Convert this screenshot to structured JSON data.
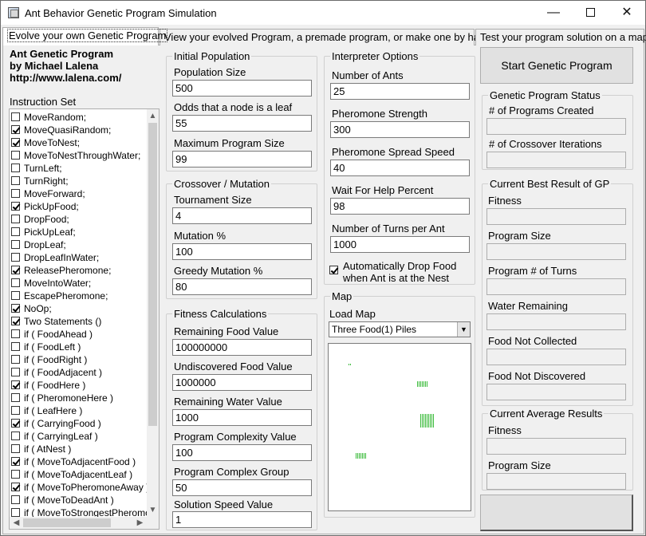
{
  "window": {
    "title": "Ant Behavior Genetic Program Simulation",
    "minimize": "—",
    "close": "✕"
  },
  "tabs": [
    {
      "label": "Evolve your own Genetic Program"
    },
    {
      "label": "View your evolved Program, a premade program, or make one by hand"
    },
    {
      "label": "Test your program solution on a map"
    }
  ],
  "credits": {
    "line1": "Ant Genetic Program",
    "line2": "by Michael Lalena",
    "line3": "http://www.lalena.com/"
  },
  "instruction_set": {
    "label": "Instruction Set",
    "items": [
      {
        "label": "MoveRandom;",
        "checked": false
      },
      {
        "label": "MoveQuasiRandom;",
        "checked": true
      },
      {
        "label": "MoveToNest;",
        "checked": true
      },
      {
        "label": "MoveToNestThroughWater;",
        "checked": false
      },
      {
        "label": "TurnLeft;",
        "checked": false
      },
      {
        "label": "TurnRight;",
        "checked": false
      },
      {
        "label": "MoveForward;",
        "checked": false
      },
      {
        "label": "PickUpFood;",
        "checked": true
      },
      {
        "label": "DropFood;",
        "checked": false
      },
      {
        "label": "PickUpLeaf;",
        "checked": false
      },
      {
        "label": "DropLeaf;",
        "checked": false
      },
      {
        "label": "DropLeafInWater;",
        "checked": false
      },
      {
        "label": "ReleasePheromone;",
        "checked": true
      },
      {
        "label": "MoveIntoWater;",
        "checked": false
      },
      {
        "label": "EscapePheromone;",
        "checked": false
      },
      {
        "label": "NoOp;",
        "checked": true
      },
      {
        "label": "Two Statements ()",
        "checked": true
      },
      {
        "label": "if ( FoodAhead )",
        "checked": false
      },
      {
        "label": "if ( FoodLeft )",
        "checked": false
      },
      {
        "label": "if ( FoodRight )",
        "checked": false
      },
      {
        "label": "if ( FoodAdjacent )",
        "checked": false
      },
      {
        "label": "if ( FoodHere )",
        "checked": true
      },
      {
        "label": "if ( PheromoneHere )",
        "checked": false
      },
      {
        "label": "if ( LeafHere )",
        "checked": false
      },
      {
        "label": "if ( CarryingFood )",
        "checked": true
      },
      {
        "label": "if ( CarryingLeaf )",
        "checked": false
      },
      {
        "label": "if ( AtNest )",
        "checked": false
      },
      {
        "label": "if ( MoveToAdjacentFood )",
        "checked": true
      },
      {
        "label": "if ( MoveToAdjacentLeaf )",
        "checked": false
      },
      {
        "label": "if ( MoveToPheromoneAway )",
        "checked": true
      },
      {
        "label": "if ( MoveToDeadAnt )",
        "checked": false
      },
      {
        "label": "if ( MoveToStrongestPheromone )",
        "checked": false
      }
    ]
  },
  "initial_population": {
    "legend": "Initial Population",
    "population_size_label": "Population Size",
    "population_size": "500",
    "odds_leaf_label": "Odds that a node is a leaf",
    "odds_leaf": "55",
    "max_program_size_label": "Maximum Program Size",
    "max_program_size": "99"
  },
  "crossover": {
    "legend": "Crossover / Mutation",
    "tournament_size_label": "Tournament Size",
    "tournament_size": "4",
    "mutation_label": "Mutation %",
    "mutation": "100",
    "greedy_mutation_label": "Greedy Mutation %",
    "greedy_mutation": "80"
  },
  "fitness": {
    "legend": "Fitness Calculations",
    "remaining_food_label": "Remaining Food Value",
    "remaining_food": "100000000",
    "undiscovered_food_label": "Undiscovered Food Value",
    "undiscovered_food": "1000000",
    "remaining_water_label": "Remaining Water Value",
    "remaining_water": "1000",
    "complexity_value_label": "Program Complexity Value",
    "complexity_value": "100",
    "complex_group_label": "Program Complex Group",
    "complex_group": "50",
    "solution_speed_label": "Solution Speed Value",
    "solution_speed": "1"
  },
  "interpreter": {
    "legend": "Interpreter Options",
    "num_ants_label": "Number of Ants",
    "num_ants": "25",
    "pheromone_strength_label": "Pheromone Strength",
    "pheromone_strength": "300",
    "pheromone_spread_label": "Pheromone Spread Speed",
    "pheromone_spread": "40",
    "wait_help_label": "Wait For Help Percent",
    "wait_help": "98",
    "turns_label": "Number of Turns per Ant",
    "turns": "1000",
    "auto_drop_label": "Automatically Drop Food\nwhen Ant is at the Nest",
    "auto_drop_checked": true
  },
  "map": {
    "legend": "Map",
    "load_map_label": "Load Map",
    "selected_map": "Three Food(1) Piles",
    "dropdown_arrow": "▼"
  },
  "start_button": {
    "label": "Start Genetic Program"
  },
  "gp_status": {
    "legend": "Genetic Program Status",
    "programs_created_label": "# of Programs Created",
    "crossover_iterations_label": "# of Crossover Iterations"
  },
  "best_result": {
    "legend": "Current Best Result of GP",
    "fitness_label": "Fitness",
    "program_size_label": "Program Size",
    "program_turns_label": "Program # of Turns",
    "water_remaining_label": "Water Remaining",
    "food_not_collected_label": "Food Not Collected",
    "food_not_discovered_label": "Food Not Discovered"
  },
  "average_results": {
    "legend": "Current Average Results",
    "fitness_label": "Fitness",
    "program_size_label": "Program Size"
  },
  "scroll_arrows": {
    "up": "▲",
    "down": "▼",
    "left": "◀",
    "right": "▶"
  },
  "colors": {
    "food": "#3bbb3b",
    "window_bg": "#f0f0f0",
    "field_bg": "#ffffff"
  }
}
